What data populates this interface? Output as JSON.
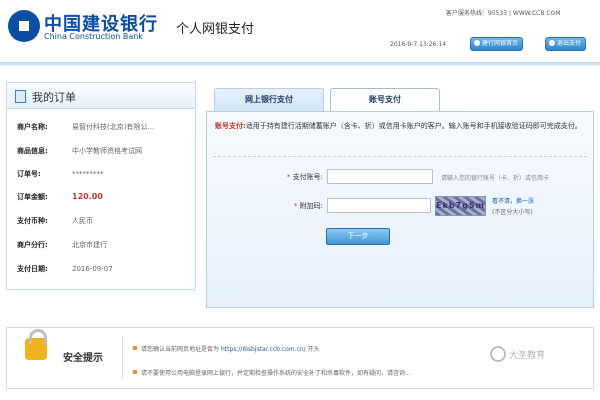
{
  "header": {
    "bank_name_cn": "中国建设银行",
    "bank_name_en": "China Construction Bank",
    "service_title": "个人网银支付",
    "hotline": "客户服务热线：95533 | WWW.CCB.COM",
    "datetime": "2016-9-7 13:26:14",
    "home_button": "建行网银首页",
    "exit_button": "退出支付"
  },
  "order": {
    "title": "我的订单",
    "rows": [
      {
        "label": "商户名称:",
        "value": "易智付科技(北京)有限公..."
      },
      {
        "label": "商品信息:",
        "value": "中小学教师资格考试网"
      },
      {
        "label": "订单号:",
        "value": "*********"
      },
      {
        "label": "订单金额:",
        "value": "120.00"
      },
      {
        "label": "支付币种:",
        "value": "人民币"
      },
      {
        "label": "商户分行:",
        "value": "北京市建行"
      },
      {
        "label": "支付日期:",
        "value": "2016-09-07"
      }
    ]
  },
  "payment": {
    "tabs": [
      "网上银行支付",
      "账号支付"
    ],
    "notice_key": "账号支付:",
    "notice_text": "适用于持有建行活期储蓄账户（含卡、折）或信用卡账户的客户。输入账号和手机接收验证码即可完成支付。",
    "account_label": "支付账号:",
    "account_hint": "请输入您的银行账号（卡、折）或信用卡",
    "captcha_label": "附加码:",
    "captcha_text": "Ekb7gSm",
    "refresh_link": "看不清，换一张",
    "case_tip": "(不区分大小写)",
    "next_button": "下一步"
  },
  "security": {
    "title": "安全提示",
    "item1_prefix": "请您确认当前网页地址是否为",
    "item1_link": "https://ibsbjstar.ccb.com.cn/",
    "item1_suffix": "开头",
    "item2": "请不要使用公用电脑登录网上银行，并定期检查操作系统的安全补丁和杀毒软件，如有疑问，请咨询..."
  },
  "watermark": "大圣教育"
}
